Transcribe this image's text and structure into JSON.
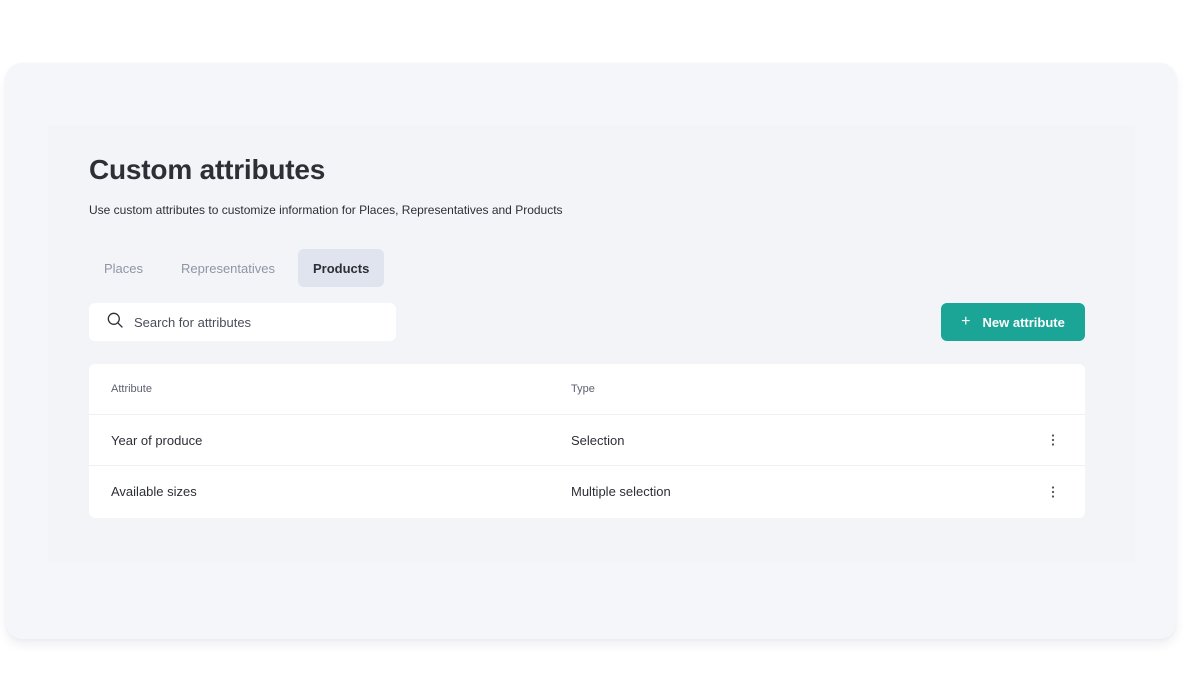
{
  "page": {
    "title": "Custom attributes",
    "subtitle": "Use custom attributes to customize information for Places, Representatives and Products"
  },
  "tabs": [
    {
      "label": "Places",
      "active": false
    },
    {
      "label": "Representatives",
      "active": false
    },
    {
      "label": "Products",
      "active": true
    }
  ],
  "search": {
    "placeholder": "Search for attributes",
    "value": "",
    "icon": "search-icon"
  },
  "new_button": {
    "label": "New attribute",
    "icon": "plus-icon"
  },
  "table": {
    "columns": [
      "Attribute",
      "Type"
    ],
    "rows": [
      {
        "attribute": "Year of produce",
        "type": "Selection",
        "action_icon": "more-vertical-icon"
      },
      {
        "attribute": "Available sizes",
        "type": "Multiple selection",
        "action_icon": "more-vertical-icon"
      }
    ]
  },
  "colors": {
    "accent": "#1aa596",
    "active_tab_bg": "#e0e4ee",
    "background": "#f4f6fa"
  }
}
